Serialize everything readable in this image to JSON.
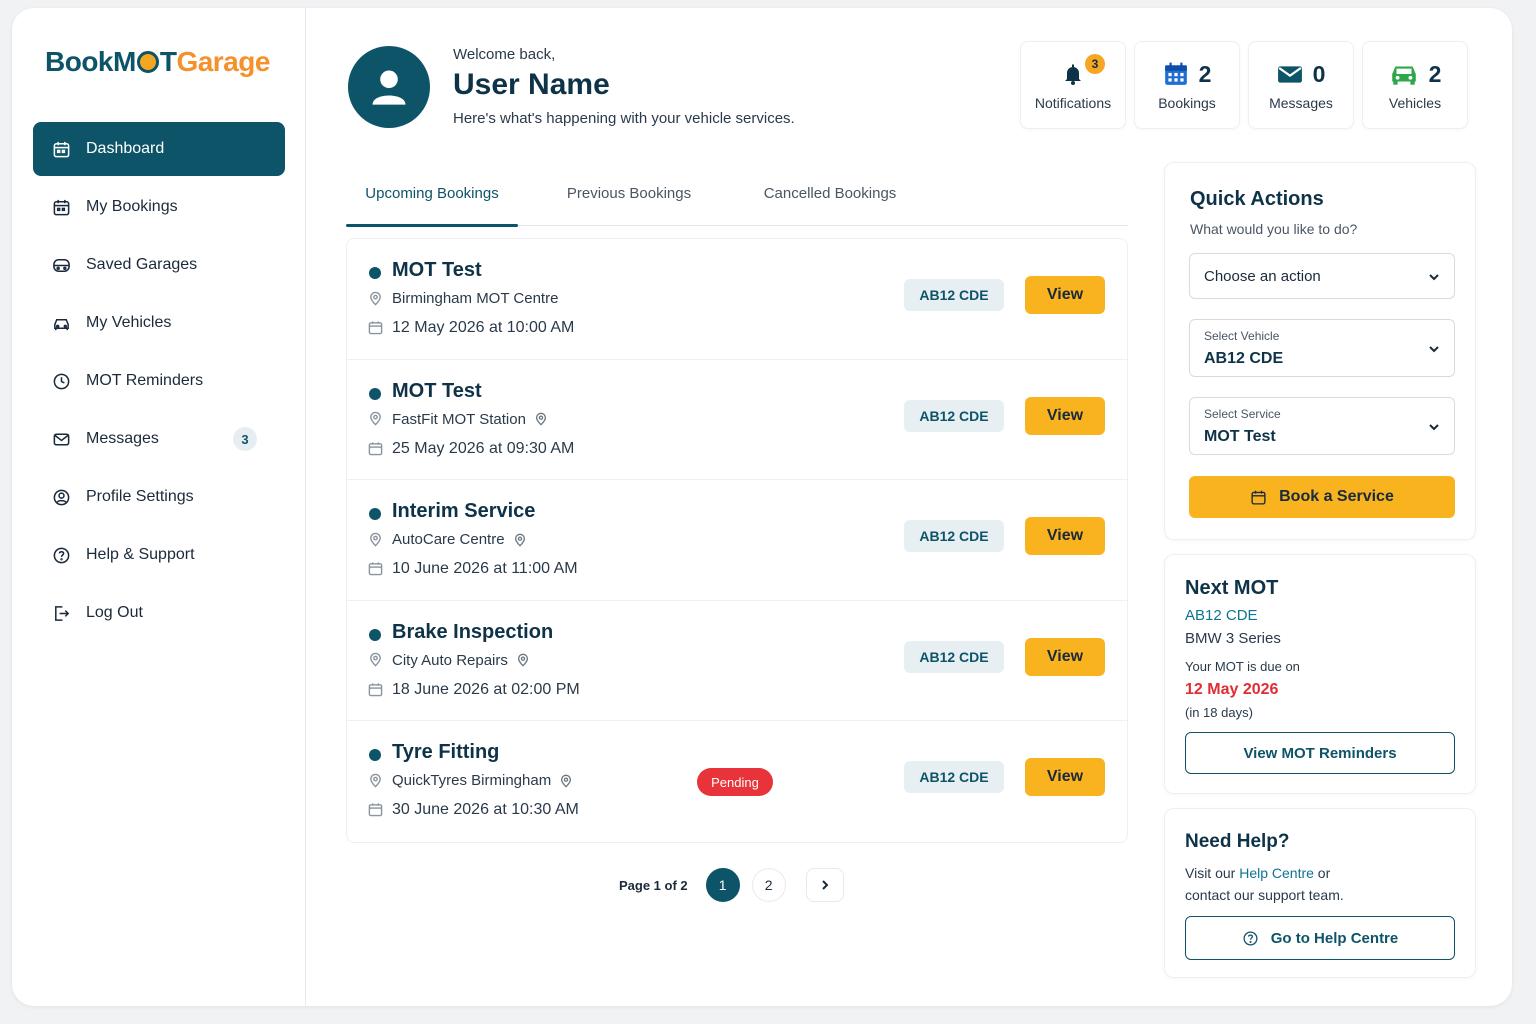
{
  "brand": {
    "part1": "BookM",
    "part2": "T",
    "part3": "Garage"
  },
  "sidebar": {
    "items": [
      {
        "label": "Dashboard",
        "icon": "calendar-icon"
      },
      {
        "label": "My Bookings",
        "icon": "calendar-icon"
      },
      {
        "label": "Saved Garages",
        "icon": "garage-icon"
      },
      {
        "label": "My Vehicles",
        "icon": "car-icon"
      },
      {
        "label": "MOT Reminders",
        "icon": "clock-icon"
      },
      {
        "label": "Messages",
        "icon": "mail-icon",
        "count": "3"
      },
      {
        "label": "Profile Settings",
        "icon": "user-circle-icon"
      },
      {
        "label": "Help & Support",
        "icon": "help-icon"
      },
      {
        "label": "Log Out",
        "icon": "logout-icon"
      }
    ]
  },
  "header": {
    "welcome": "Welcome back,",
    "user_name": "User Name",
    "subtitle": "Here's what's happening with your vehicle services."
  },
  "stats": {
    "notifications": {
      "label": "Notifications",
      "badge": "3"
    },
    "bookings": {
      "label": "Bookings",
      "value": "2"
    },
    "messages": {
      "label": "Messages",
      "value": "0"
    },
    "vehicles": {
      "label": "Vehicles",
      "value": "2"
    }
  },
  "tabs": [
    "Upcoming Bookings",
    "Previous Bookings",
    "Cancelled Bookings"
  ],
  "bookings": [
    {
      "title": "MOT Test",
      "location": "Birmingham MOT Centre",
      "datetime": "12 May 2026 at 10:00 AM",
      "plate": "AB12 CDE",
      "action": "View"
    },
    {
      "title": "MOT Test",
      "location": "FastFit MOT Station",
      "datetime": "25 May 2026 at 09:30 AM",
      "plate": "AB12 CDE",
      "action": "View"
    },
    {
      "title": "Interim Service",
      "location": "AutoCare Centre",
      "datetime": "10 June 2026 at 11:00 AM",
      "plate": "AB12 CDE",
      "action": "View"
    },
    {
      "title": "Brake Inspection",
      "location": "City Auto Repairs",
      "datetime": "18 June 2026 at 02:00 PM",
      "plate": "AB12 CDE",
      "action": "View"
    },
    {
      "title": "Tyre Fitting",
      "location": "QuickTyres Birmingham",
      "datetime": "30 June 2026 at 10:30 AM",
      "plate": "AB12 CDE",
      "action": "View",
      "status": "Pending"
    }
  ],
  "pagination": {
    "text": "Page 1 of 2",
    "pages": [
      "1",
      "2"
    ]
  },
  "quick_actions": {
    "title": "Quick Actions",
    "subtitle": "What would you like to do?",
    "action_select": "Choose an action",
    "vehicle_label": "Select Vehicle",
    "vehicle_value": "AB12 CDE",
    "service_label": "Select Service",
    "service_value": "MOT Test",
    "book_button": "Book a Service"
  },
  "next_mot": {
    "title": "Next MOT",
    "plate": "AB12 CDE",
    "model": "BMW 3 Series",
    "due_text": "Your MOT is due on",
    "due_date": "12 May 2026",
    "days": "(in 18 days)",
    "button": "View MOT Reminders"
  },
  "help": {
    "title": "Need Help?",
    "line1_pre": "Visit our ",
    "line1_link": "Help Centre",
    "line1_post": " or",
    "line2": "contact our support team.",
    "button": "Go to Help Centre"
  },
  "colors": {
    "primary": "#0e5468",
    "accent": "#f9b31f",
    "danger": "#e02d35",
    "brand_orange": "#f5902a"
  }
}
